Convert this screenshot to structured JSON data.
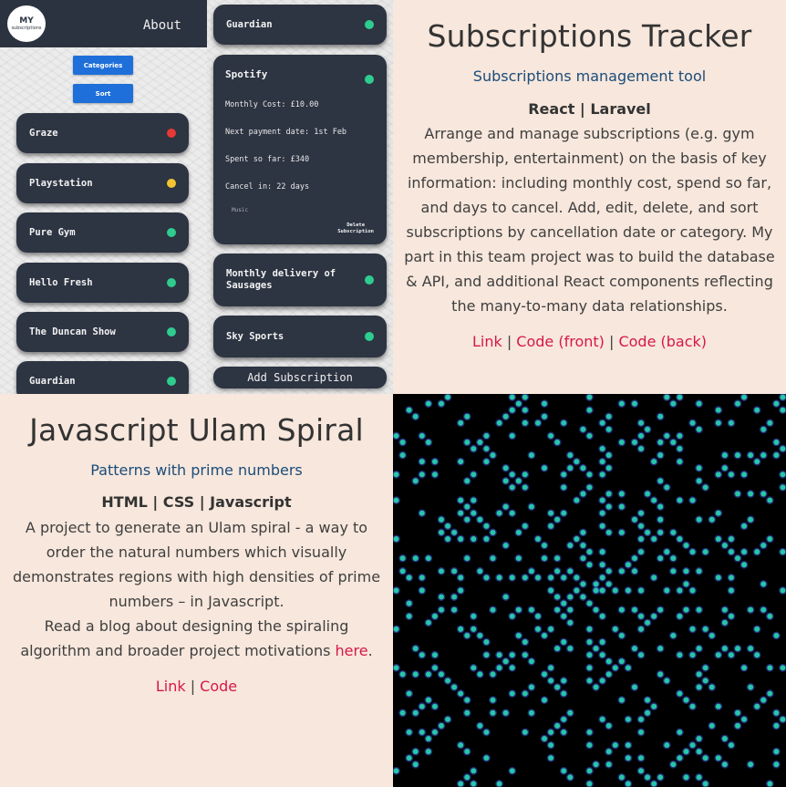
{
  "app_screenshot": {
    "logo": {
      "line1": "MY",
      "line2": "subscriptions"
    },
    "about_label": "About",
    "buttons": {
      "categories": "Categories",
      "sort": "Sort"
    },
    "left_list": [
      {
        "name": "Graze",
        "dot_color": "#e53935"
      },
      {
        "name": "Playstation",
        "dot_color": "#f4c430"
      },
      {
        "name": "Pure Gym",
        "dot_color": "#2ecc8f"
      },
      {
        "name": "Hello Fresh",
        "dot_color": "#2ecc8f"
      },
      {
        "name": "The Duncan Show",
        "dot_color": "#2ecc8f"
      },
      {
        "name": "Guardian",
        "dot_color": "#2ecc8f"
      }
    ],
    "right_list": {
      "top": {
        "name": "Guardian",
        "dot_color": "#2ecc8f"
      },
      "expanded": {
        "name": "Spotify",
        "dot_color": "#2ecc8f",
        "monthly_cost": "Monthly Cost: £10.00",
        "next_payment": "Next payment date: 1st Feb",
        "spent": "Spent so far: £340",
        "cancel_in": "Cancel in: 22 days",
        "category": "Music",
        "delete_label_1": "Delete",
        "delete_label_2": "Subscription"
      },
      "sausages": {
        "name_line1": "Monthly delivery of",
        "name_line2": "Sausages",
        "dot_color": "#2ecc8f"
      },
      "sky": {
        "name": "Sky Sports",
        "dot_color": "#2ecc8f"
      }
    },
    "add_button": "Add Subscription"
  },
  "project1": {
    "title": "Subscriptions Tracker",
    "tagline": "Subscriptions management tool",
    "stack": "React | Laravel",
    "description": "Arrange and manage subscriptions (e.g. gym membership, entertainment) on the basis of key information: including monthly cost, spend so far, and days to cancel. Add, edit, delete, and sort subscriptions by cancellation date or category. My part in this team project was to build the database & API, and additional React components reflecting the many-to-many data relationships.",
    "links": {
      "link": "Link",
      "sep1": " | ",
      "code_front": "Code (front)",
      "sep2": " | ",
      "code_back": "Code (back)"
    }
  },
  "project2": {
    "title": "Javascript Ulam Spiral",
    "tagline": "Patterns with prime numbers",
    "stack": "HTML | CSS | Javascript",
    "description": "A project to generate an Ulam spiral - a way to order the natural numbers which visually demonstrates regions with high densities of prime numbers – in Javascript.",
    "blog_text": "Read a blog about designing the spiraling algorithm and broader project motivations ",
    "blog_link": "here",
    "blog_end": ".",
    "links": {
      "link": "Link",
      "sep": " | ",
      "code": "Code"
    }
  },
  "colors": {
    "page_bg": "#f7e7dc",
    "link": "#d6174b",
    "tagline": "#1b4c7a",
    "card": "#2d3442",
    "spiral_fill": "#27c6a8",
    "spiral_edge": "#3b4fd0"
  }
}
